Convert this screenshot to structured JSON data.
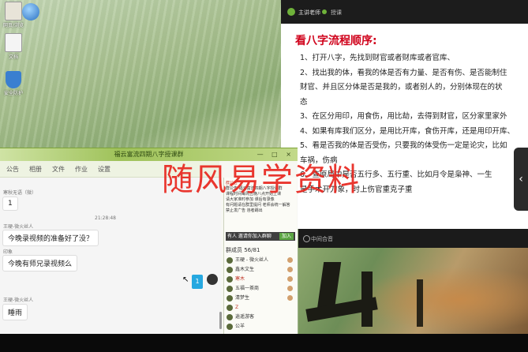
{
  "desktop": {
    "icons": [
      {
        "label": "网页/浏览"
      },
      {
        "label": "文档"
      },
      {
        "label": "安全防护"
      }
    ]
  },
  "chat": {
    "title": "福云富流四期八字授课群",
    "controls": "— □ ×",
    "tabs": [
      "公告",
      "相册",
      "文件",
      "作业",
      "设置"
    ],
    "messages": [
      {
        "sender": "寒秋无语（微）",
        "text": "1"
      },
      {
        "sender": "王硬-微火丝人",
        "text": "今晚录视频的准备好了没？",
        "time": "21:28:48"
      },
      {
        "sender": "印象",
        "text": "今晚有师兄录视频么"
      },
      {
        "sender": "王硬-微火丝人",
        "text": "睡雨"
      }
    ],
    "my_reply": "1",
    "notice": {
      "header": "群公告",
      "lines": [
        "群公告 福云富流四期八字授课群",
        "课程时间每周五晚八点开始上课",
        "请大家准时参加 课后有录像",
        "有问题请在群里提问 老师会统一解答",
        "禁止发广告 违者踢出"
      ]
    },
    "join_bar": {
      "text": "有人 邀请你加入群聊",
      "button": "加入"
    },
    "members_header": "群成员 56/81",
    "members": [
      "王硬 - 微火丝人",
      "鑫木文生",
      "寒木",
      "五福一茶商",
      "清梦生",
      "Z",
      "逍遥游客",
      "公羊"
    ]
  },
  "presentation": {
    "top_left": "主讲老师",
    "top_right": "授课",
    "slide_title": "看八字流程顺序:",
    "slide_lines": [
      "1、打开八字，先找到财官或者财库或者官库、",
      "2、找出我的体，看我的体是否有力量、是否有伤、是否能制住",
      "财官、并且区分体是否是我的，或者别人的，分别体现在的状",
      "态",
      "3、在区分用印，用食伤，用比劫，去得到财官，区分家里家外",
      "4、如果有库我们区分，是用比开库，食伤开库，还是用印开库、",
      "5、看是否我的体是否受伤，只要我的体受伤一定是论灾，比如",
      "车祸，伤病",
      "6、查原局中是否五行多、五行重、比如月令是枭神、一生",
      "是手术开刀象，时上伤官重克子重"
    ],
    "watermark": "随风易学资料",
    "video_bar_label": "中间合音"
  },
  "colors": {
    "accent_green": "#6fb23a",
    "slide_title": "#d0021b",
    "watermark": "#e8261e",
    "reply_badge": "#26a8e0"
  }
}
